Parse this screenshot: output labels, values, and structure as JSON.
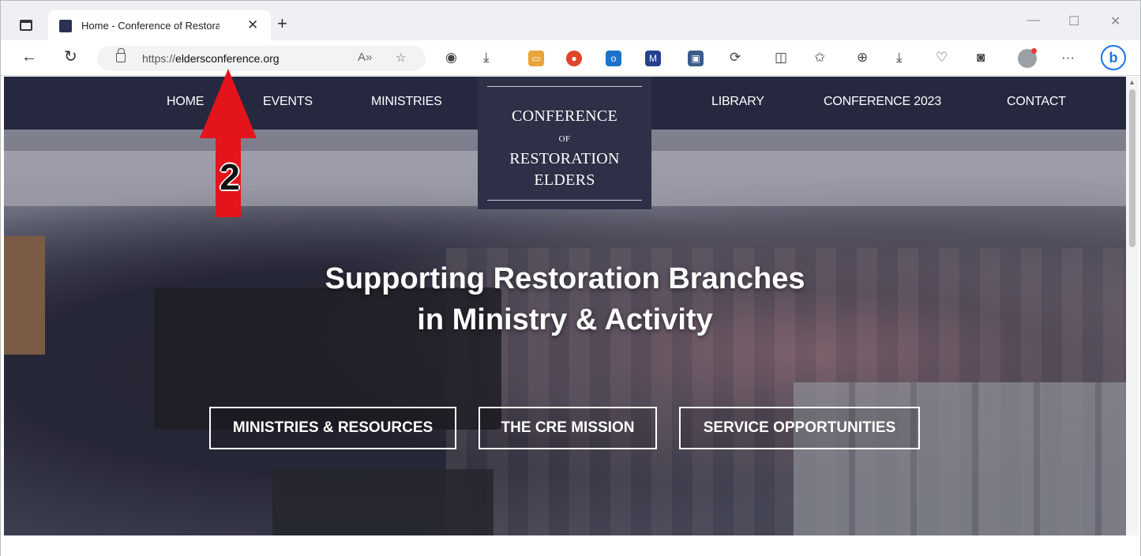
{
  "browser": {
    "tab_title": "Home - Conference of Restoratio",
    "url_prefix": "https://",
    "url_domain": "eldersconference.org",
    "new_tab": "+",
    "tab_close": "✕"
  },
  "site": {
    "nav": [
      "HOME",
      "EVENTS",
      "MINISTRIES",
      "LIBRARY",
      "CONFERENCE 2023",
      "CONTACT"
    ],
    "logo": {
      "line1": "CONFERENCE",
      "line2": "OF",
      "line3": "RESTORATION",
      "line4": "ELDERS"
    },
    "headline_line1": "Supporting Restoration Branches",
    "headline_line2": "in Ministry & Activity",
    "buttons": [
      "MINISTRIES & RESOURCES",
      "THE CRE MISSION",
      "SERVICE OPPORTUNITIES"
    ]
  },
  "annotation": {
    "number": "2",
    "color": "#e3141b"
  },
  "colors": {
    "nav_bg": "#25283f",
    "logo_bg": "#2e3047"
  }
}
